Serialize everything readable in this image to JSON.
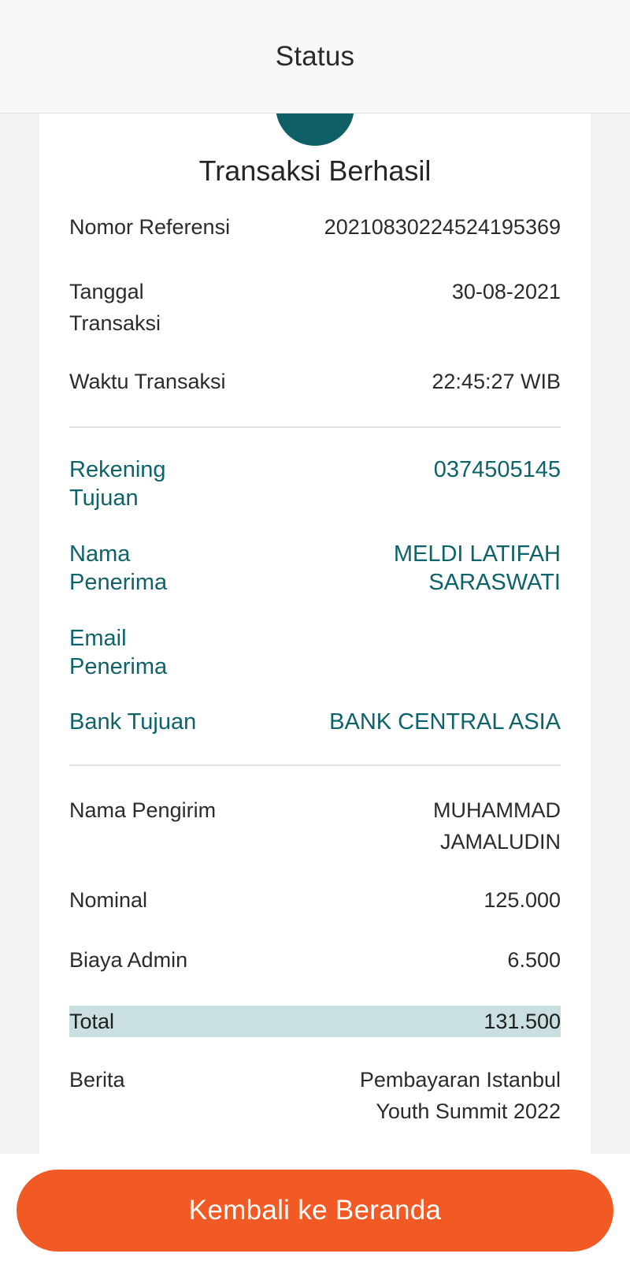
{
  "header": {
    "title": "Status"
  },
  "receipt": {
    "title": "Transaksi Berhasil",
    "reference": {
      "label": "Nomor Referensi",
      "value": "20210830224524195369"
    },
    "date": {
      "label_line1": "Tanggal",
      "label_line2": "Transaksi",
      "value": "30-08-2021"
    },
    "time": {
      "label": "Waktu Transaksi",
      "value": "22:45:27 WIB"
    },
    "destination_account": {
      "label_line1": "Rekening",
      "label_line2": "Tujuan",
      "value": "0374505145"
    },
    "recipient_name": {
      "label_line1": "Nama",
      "label_line2": "Penerima",
      "value_line1": "MELDI LATIFAH",
      "value_line2": "SARASWATI"
    },
    "recipient_email": {
      "label_line1": "Email",
      "label_line2": "Penerima",
      "value": ""
    },
    "destination_bank": {
      "label": "Bank Tujuan",
      "value": "BANK CENTRAL ASIA"
    },
    "sender_name": {
      "label": "Nama Pengirim",
      "value_line1": "MUHAMMAD",
      "value_line2": "JAMALUDIN"
    },
    "amount": {
      "label": "Nominal",
      "value": "125.000"
    },
    "admin_fee": {
      "label": "Biaya Admin",
      "value": "6.500"
    },
    "total": {
      "label": "Total",
      "value": "131.500"
    },
    "message": {
      "label": "Berita",
      "value_line1": "Pembayaran Istanbul",
      "value_line2": "Youth Summit 2022"
    }
  },
  "footer": {
    "button_label": "Kembali ke Beranda"
  },
  "colors": {
    "accent": "#0d6369",
    "button": "#f15a24",
    "total_highlight": "#c9dfe0"
  }
}
